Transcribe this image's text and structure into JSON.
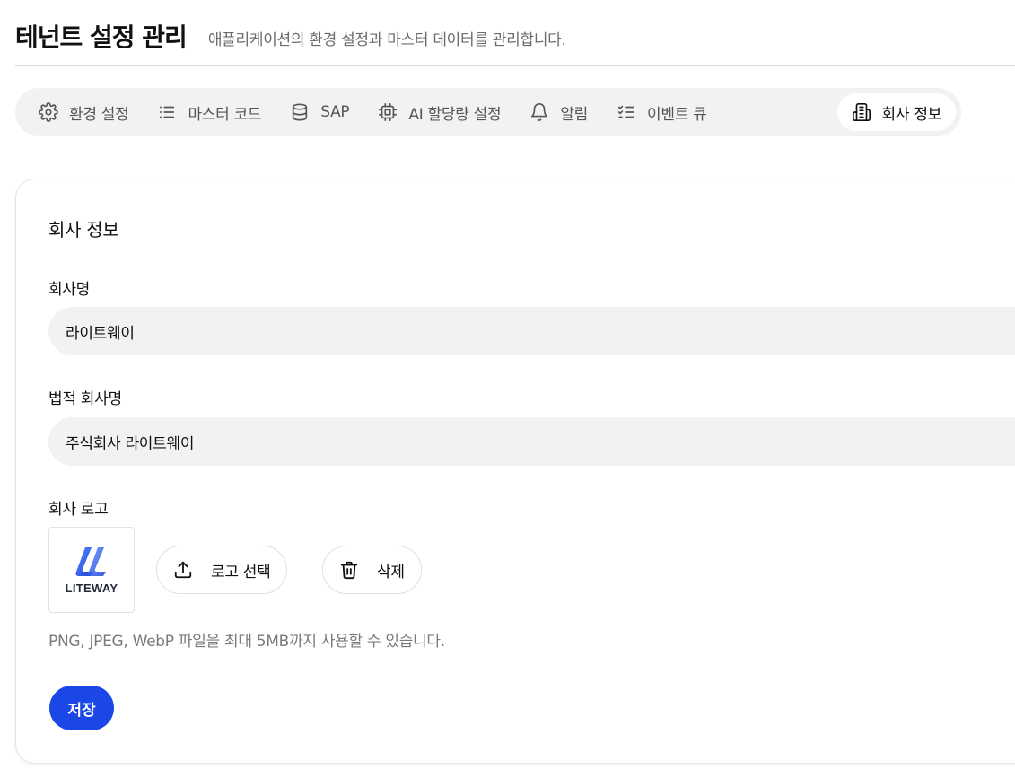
{
  "header": {
    "title": "테넌트 설정 관리",
    "subtitle": "애플리케이션의 환경 설정과 마스터 데이터를 관리합니다."
  },
  "tabs": [
    {
      "label": "환경 설정",
      "icon": "gear-icon"
    },
    {
      "label": "마스터 코드",
      "icon": "list-icon"
    },
    {
      "label": "SAP",
      "icon": "database-icon"
    },
    {
      "label": "AI 할당량 설정",
      "icon": "cpu-chip-icon"
    },
    {
      "label": "알림",
      "icon": "bell-icon"
    },
    {
      "label": "이벤트 큐",
      "icon": "checklist-icon"
    },
    {
      "label": "회사 정보",
      "icon": "building-icon",
      "active": true
    }
  ],
  "company": {
    "section_title": "회사 정보",
    "name_label": "회사명",
    "name_value": "라이트웨이",
    "legal_name_label": "법적 회사명",
    "legal_name_value": "주식회사 라이트웨이",
    "logo_label": "회사 로고",
    "logo_text": "LITEWAY",
    "select_logo_label": "로고 선택",
    "delete_label": "삭제",
    "help_text": "PNG, JPEG, WebP 파일을 최대 5MB까지 사용할 수 있습니다.",
    "save_label": "저장"
  },
  "colors": {
    "primary": "#1a47e6",
    "tab_bar_bg": "#f2f2f2",
    "input_bg": "#f2f2f2",
    "logo_blue": "#2f6bff"
  }
}
